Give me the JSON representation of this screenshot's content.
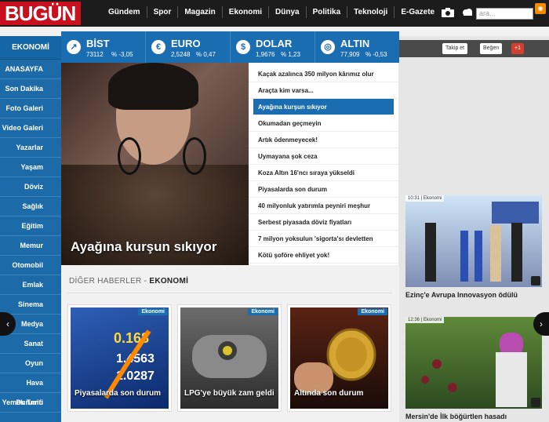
{
  "logo": "BUGÜN",
  "topnav": [
    "Gündem",
    "Spor",
    "Magazin",
    "Ekonomi",
    "Dünya",
    "Politika",
    "Teknoloji",
    "E-Gazete"
  ],
  "search_placeholder": "ara...",
  "sidebar": {
    "title": "EKONOMİ",
    "items": [
      "ANASAYFA",
      "Son Dakika",
      "Foto Galeri",
      "Video Galeri",
      "Yazarlar",
      "Yaşam",
      "Döviz",
      "Sağlık",
      "Eğitim",
      "Memur",
      "Otomobil",
      "Emlak",
      "Sinema",
      "Medya",
      "Sanat",
      "Oyun",
      "Hava Durumu",
      "Yemek Tarifi"
    ]
  },
  "ticker": [
    {
      "name": "BİST",
      "value": "73112",
      "pct": "% -3,05",
      "icon": "chart-icon"
    },
    {
      "name": "EURO",
      "value": "2,5248",
      "pct": "% 0,47",
      "icon": "euro-icon"
    },
    {
      "name": "DOLAR",
      "value": "1,9676",
      "pct": "% 1,23",
      "icon": "dollar-icon"
    },
    {
      "name": "ALTIN",
      "value": "77,909",
      "pct": "% -0,53",
      "icon": "gold-icon"
    }
  ],
  "main_story": {
    "title": "Ayağına kurşun sıkıyor"
  },
  "headlines": [
    "Kaçak azalınca 350 milyon kârımız olur",
    "Araçta kim varsa...",
    "Ayağına kurşun sıkıyor",
    "Okumadan geçmeyin",
    "Artık ödenmeyecek!",
    "Uymayana şok ceza",
    "Koza Altın 16'ncı sıraya yükseldi",
    "Piyasalarda son durum",
    "40 milyonluk yatırımla peyniri meşhur",
    "Serbest piyasada döviz fiyatları",
    "7 milyon yoksulun 'sigorta'sı devletten",
    "Kötü şoföre ehliyet yok!"
  ],
  "active_headline": 2,
  "social": {
    "twitter": "Takip et",
    "facebook": "Beğen",
    "gplus": "+1"
  },
  "section": {
    "prefix": "DİĞER HABERLER - ",
    "name": "EKONOMİ"
  },
  "cards": [
    {
      "badge": "Ekonomi",
      "caption": "Piyasalarda son durum"
    },
    {
      "badge": "Ekonomi",
      "caption": "LPG'ye büyük zam geldi"
    },
    {
      "badge": "Ekonomi",
      "caption": "Altında son durum"
    }
  ],
  "right_news": [
    {
      "time": "10:31 | Ekonomi",
      "caption": "Ezinç'e Avrupa Innovasyon ödülü"
    },
    {
      "time": "12:36 | Ekonomi",
      "caption": "Mersin'de İlk böğürtlen hasadı"
    }
  ]
}
